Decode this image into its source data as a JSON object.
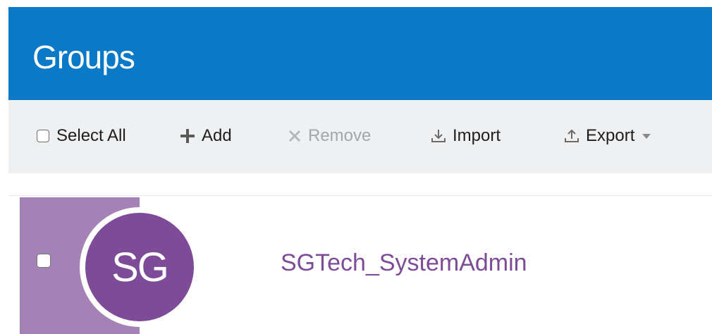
{
  "header": {
    "title": "Groups"
  },
  "toolbar": {
    "select_all_label": "Select All",
    "add_label": "Add",
    "remove_label": "Remove",
    "import_label": "Import",
    "export_label": "Export"
  },
  "groups": [
    {
      "initials": "SG",
      "name": "SGTech_SystemAdmin"
    }
  ],
  "colors": {
    "header_bg": "#0a79c7",
    "toolbar_bg": "#eef0f1",
    "accent_purple": "#7e4b99",
    "selection_strip": "#a482b5",
    "disabled_text": "#a4a7aa"
  },
  "icons": {
    "add": "plus-icon",
    "remove": "x-icon",
    "import": "download-icon",
    "export": "upload-icon",
    "export_menu": "caret-down-icon"
  }
}
